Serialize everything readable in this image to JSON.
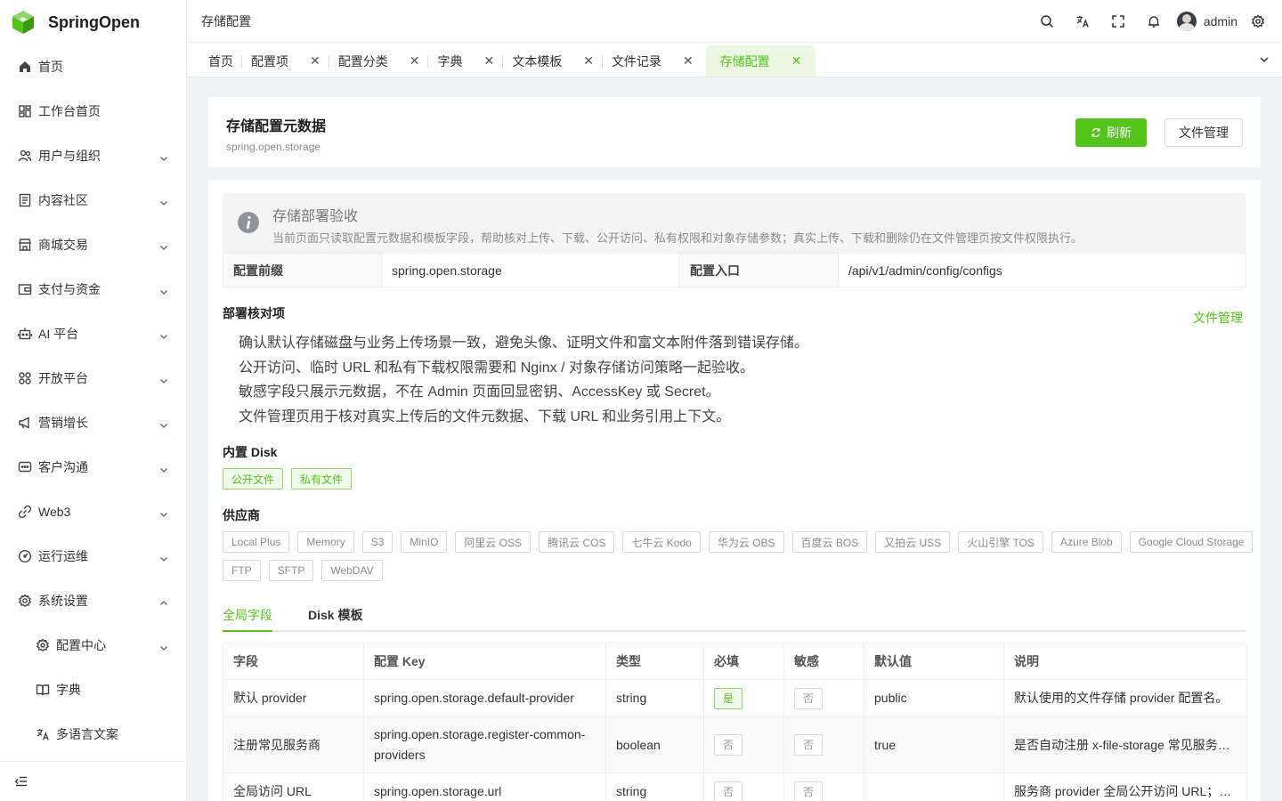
{
  "app": {
    "name": "SpringOpen"
  },
  "sidebar": {
    "items": [
      {
        "label": "首页",
        "icon": "home-icon"
      },
      {
        "label": "工作台首页",
        "icon": "dashboard-icon"
      },
      {
        "label": "用户与组织",
        "icon": "users-icon"
      },
      {
        "label": "内容社区",
        "icon": "document-icon"
      },
      {
        "label": "商城交易",
        "icon": "store-icon"
      },
      {
        "label": "支付与资金",
        "icon": "wallet-icon"
      },
      {
        "label": "AI 平台",
        "icon": "robot-icon"
      },
      {
        "label": "开放平台",
        "icon": "apps-icon"
      },
      {
        "label": "营销增长",
        "icon": "megaphone-icon"
      },
      {
        "label": "客户沟通",
        "icon": "chat-icon"
      },
      {
        "label": "Web3",
        "icon": "link-icon"
      },
      {
        "label": "运行运维",
        "icon": "gauge-icon"
      },
      {
        "label": "系统设置",
        "icon": "gear-icon"
      },
      {
        "label": "配置中心",
        "icon": "config-icon"
      },
      {
        "label": "字典",
        "icon": "book-icon"
      },
      {
        "label": "多语言文案",
        "icon": "translate-icon"
      }
    ]
  },
  "header": {
    "breadcrumb": "存储配置",
    "username": "admin"
  },
  "tabs": [
    {
      "label": "首页"
    },
    {
      "label": "配置项"
    },
    {
      "label": "配置分类"
    },
    {
      "label": "字典"
    },
    {
      "label": "文本模板"
    },
    {
      "label": "文件记录"
    },
    {
      "label": "存储配置"
    }
  ],
  "page": {
    "title": "存储配置元数据",
    "subtitle": "spring.open.storage",
    "refresh_label": "刷新",
    "file_manage_label": "文件管理"
  },
  "alert": {
    "title": "存储部署验收",
    "description": "当前页面只读取配置元数据和模板字段，帮助核对上传、下载、公开访问、私有权限和对象存储参数；真实上传、下载和删除仍在文件管理页按文件权限执行。"
  },
  "descriptions": {
    "prefix_label": "配置前缀",
    "prefix_value": "spring.open.storage",
    "entry_label": "配置入口",
    "entry_value": "/api/v1/admin/config/configs"
  },
  "checklist": {
    "title": "部署核对项",
    "link": "文件管理",
    "items": [
      "确认默认存储磁盘与业务上传场景一致，避免头像、证明文件和富文本附件落到错误存储。",
      "公开访问、临时 URL 和私有下载权限需要和 Nginx / 对象存储访问策略一起验收。",
      "敏感字段只展示元数据，不在 Admin 页面回显密钥、AccessKey 或 Secret。",
      "文件管理页用于核对真实上传后的文件元数据、下载 URL 和业务引用上下文。"
    ]
  },
  "disks": {
    "title": "内置 Disk",
    "items": [
      "公开文件",
      "私有文件"
    ]
  },
  "providers": {
    "title": "供应商",
    "items": [
      "Local Plus",
      "Memory",
      "S3",
      "MinIO",
      "阿里云 OSS",
      "腾讯云 COS",
      "七牛云 Kodo",
      "华为云 OBS",
      "百度云 BOS",
      "又拍云 USS",
      "火山引擎 TOS",
      "Azure Blob",
      "Google Cloud Storage",
      "FTP",
      "SFTP",
      "WebDAV"
    ]
  },
  "subtabs": {
    "global": "全局字段",
    "disk": "Disk 模板"
  },
  "table": {
    "headers": [
      "字段",
      "配置 Key",
      "类型",
      "必填",
      "敏感",
      "默认值",
      "说明"
    ],
    "rows": [
      [
        "默认 provider",
        "spring.open.storage.default-provider",
        "string",
        "是",
        "否",
        "public",
        "默认使用的文件存储 provider 配置名。"
      ],
      [
        "注册常见服务商",
        "spring.open.storage.register-common-providers",
        "boolean",
        "否",
        "否",
        "true",
        "是否自动注册 x-file-storage 常见服务…"
      ],
      [
        "全局访问 URL",
        "spring.open.storage.url",
        "string",
        "否",
        "否",
        "",
        "服务商 provider 全局公开访问 URL；…"
      ]
    ]
  },
  "colors": {
    "accent": "#52c41a"
  }
}
